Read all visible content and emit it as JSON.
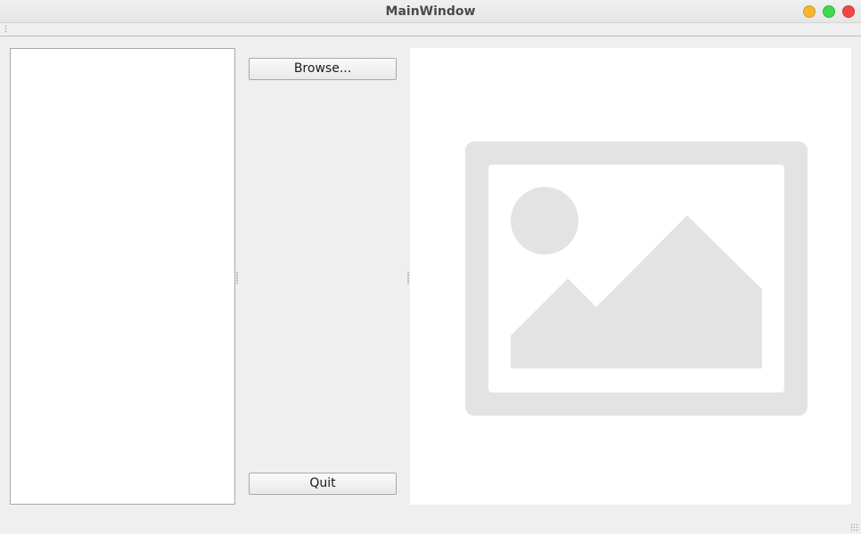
{
  "window": {
    "title": "MainWindow"
  },
  "controls": {
    "browse_label": "Browse...",
    "quit_label": "Quit"
  },
  "image_view": {
    "icon": "image-placeholder-icon",
    "placeholder_color": "#e3e3e3"
  },
  "colors": {
    "close": "#f04848",
    "minimize": "#f5b730",
    "maximize": "#3fd94d"
  }
}
